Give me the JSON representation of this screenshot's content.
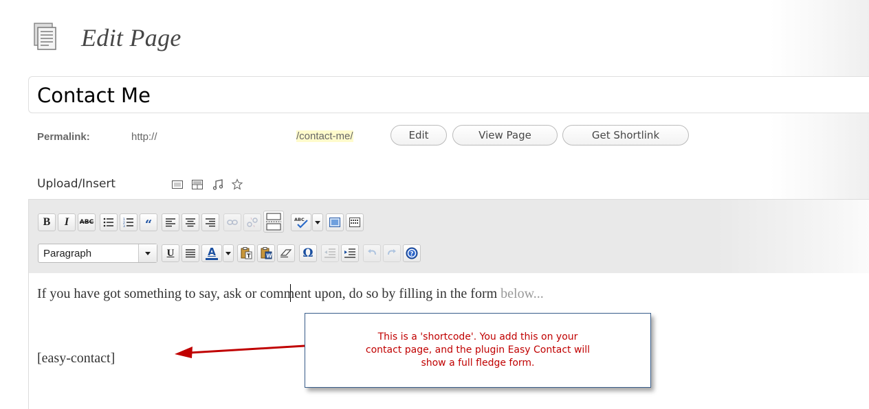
{
  "header": {
    "title": "Edit Page",
    "icon": "page-icon"
  },
  "title_field": {
    "value": "Contact Me"
  },
  "permalink": {
    "label": "Permalink:",
    "base": "http://",
    "slug": "/contact-me/",
    "buttons": {
      "edit": "Edit",
      "view": "View Page",
      "shortlink": "Get Shortlink"
    }
  },
  "upload": {
    "label": "Upload/Insert",
    "icons": [
      "add-image-icon",
      "add-gallery-icon",
      "add-audio-icon",
      "add-media-icon"
    ]
  },
  "toolbar": {
    "row1": [
      "bold-icon",
      "italic-icon",
      "strikethrough-icon",
      "bullet-list-icon",
      "numbered-list-icon",
      "blockquote-icon",
      "align-left-icon",
      "align-center-icon",
      "align-right-icon",
      "insert-link-icon",
      "unlink-icon",
      "more-tag-icon",
      "spellcheck-icon",
      "dropdown-arrow-icon",
      "fullscreen-icon",
      "kitchen-sink-icon"
    ],
    "format_value": "Paragraph",
    "row2": [
      "underline-icon",
      "justify-icon",
      "text-color-icon",
      "dropdown-arrow-icon",
      "paste-text-icon",
      "paste-word-icon",
      "clear-formatting-icon",
      "special-character-icon",
      "outdent-icon",
      "indent-icon",
      "undo-icon",
      "redo-icon",
      "help-icon"
    ],
    "bold_glyph": "B",
    "italic_glyph": "I",
    "strike_glyph": "ABC",
    "underline_glyph": "U",
    "textcolor_glyph": "A",
    "omega_glyph": "Ω"
  },
  "content": {
    "line1_main": "If you have got something to say, ask or comment upon, do so by filling in the form",
    "line1_faded": " below...",
    "shortcode": "[easy-contact]"
  },
  "callout": {
    "lines": [
      "This is a 'shortcode'. You add this on your",
      "contact page, and the plugin Easy Contact will",
      "show a full fledge form."
    ],
    "text_color": "#c00000",
    "arrow_color": "#c00000"
  }
}
